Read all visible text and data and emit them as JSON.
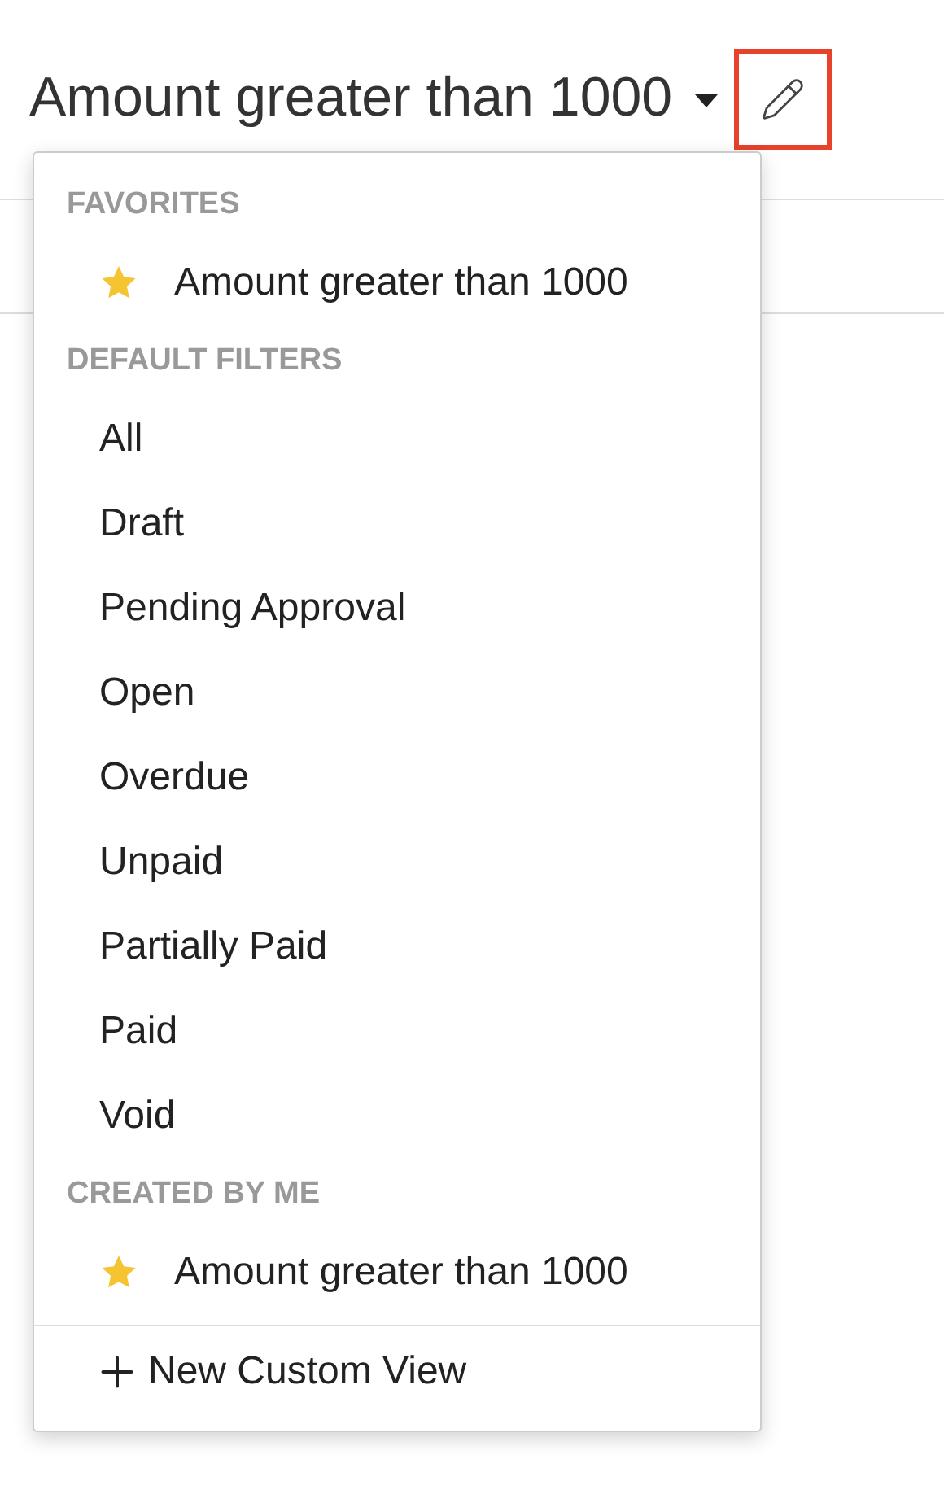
{
  "title": "Amount greater than 1000",
  "edit_highlighted": true,
  "menu": {
    "sections": [
      {
        "heading": "FAVORITES",
        "items": [
          {
            "label": "Amount greater than 1000",
            "starred": true
          }
        ]
      },
      {
        "heading": "DEFAULT FILTERS",
        "items": [
          {
            "label": "All",
            "starred": false
          },
          {
            "label": "Draft",
            "starred": false
          },
          {
            "label": "Pending Approval",
            "starred": false
          },
          {
            "label": "Open",
            "starred": false
          },
          {
            "label": "Overdue",
            "starred": false
          },
          {
            "label": "Unpaid",
            "starred": false
          },
          {
            "label": "Partially Paid",
            "starred": false
          },
          {
            "label": "Paid",
            "starred": false
          },
          {
            "label": "Void",
            "starred": false
          }
        ]
      },
      {
        "heading": "CREATED BY ME",
        "items": [
          {
            "label": "Amount greater than 1000",
            "starred": true
          }
        ]
      }
    ],
    "footer": {
      "label": "New Custom View"
    }
  }
}
